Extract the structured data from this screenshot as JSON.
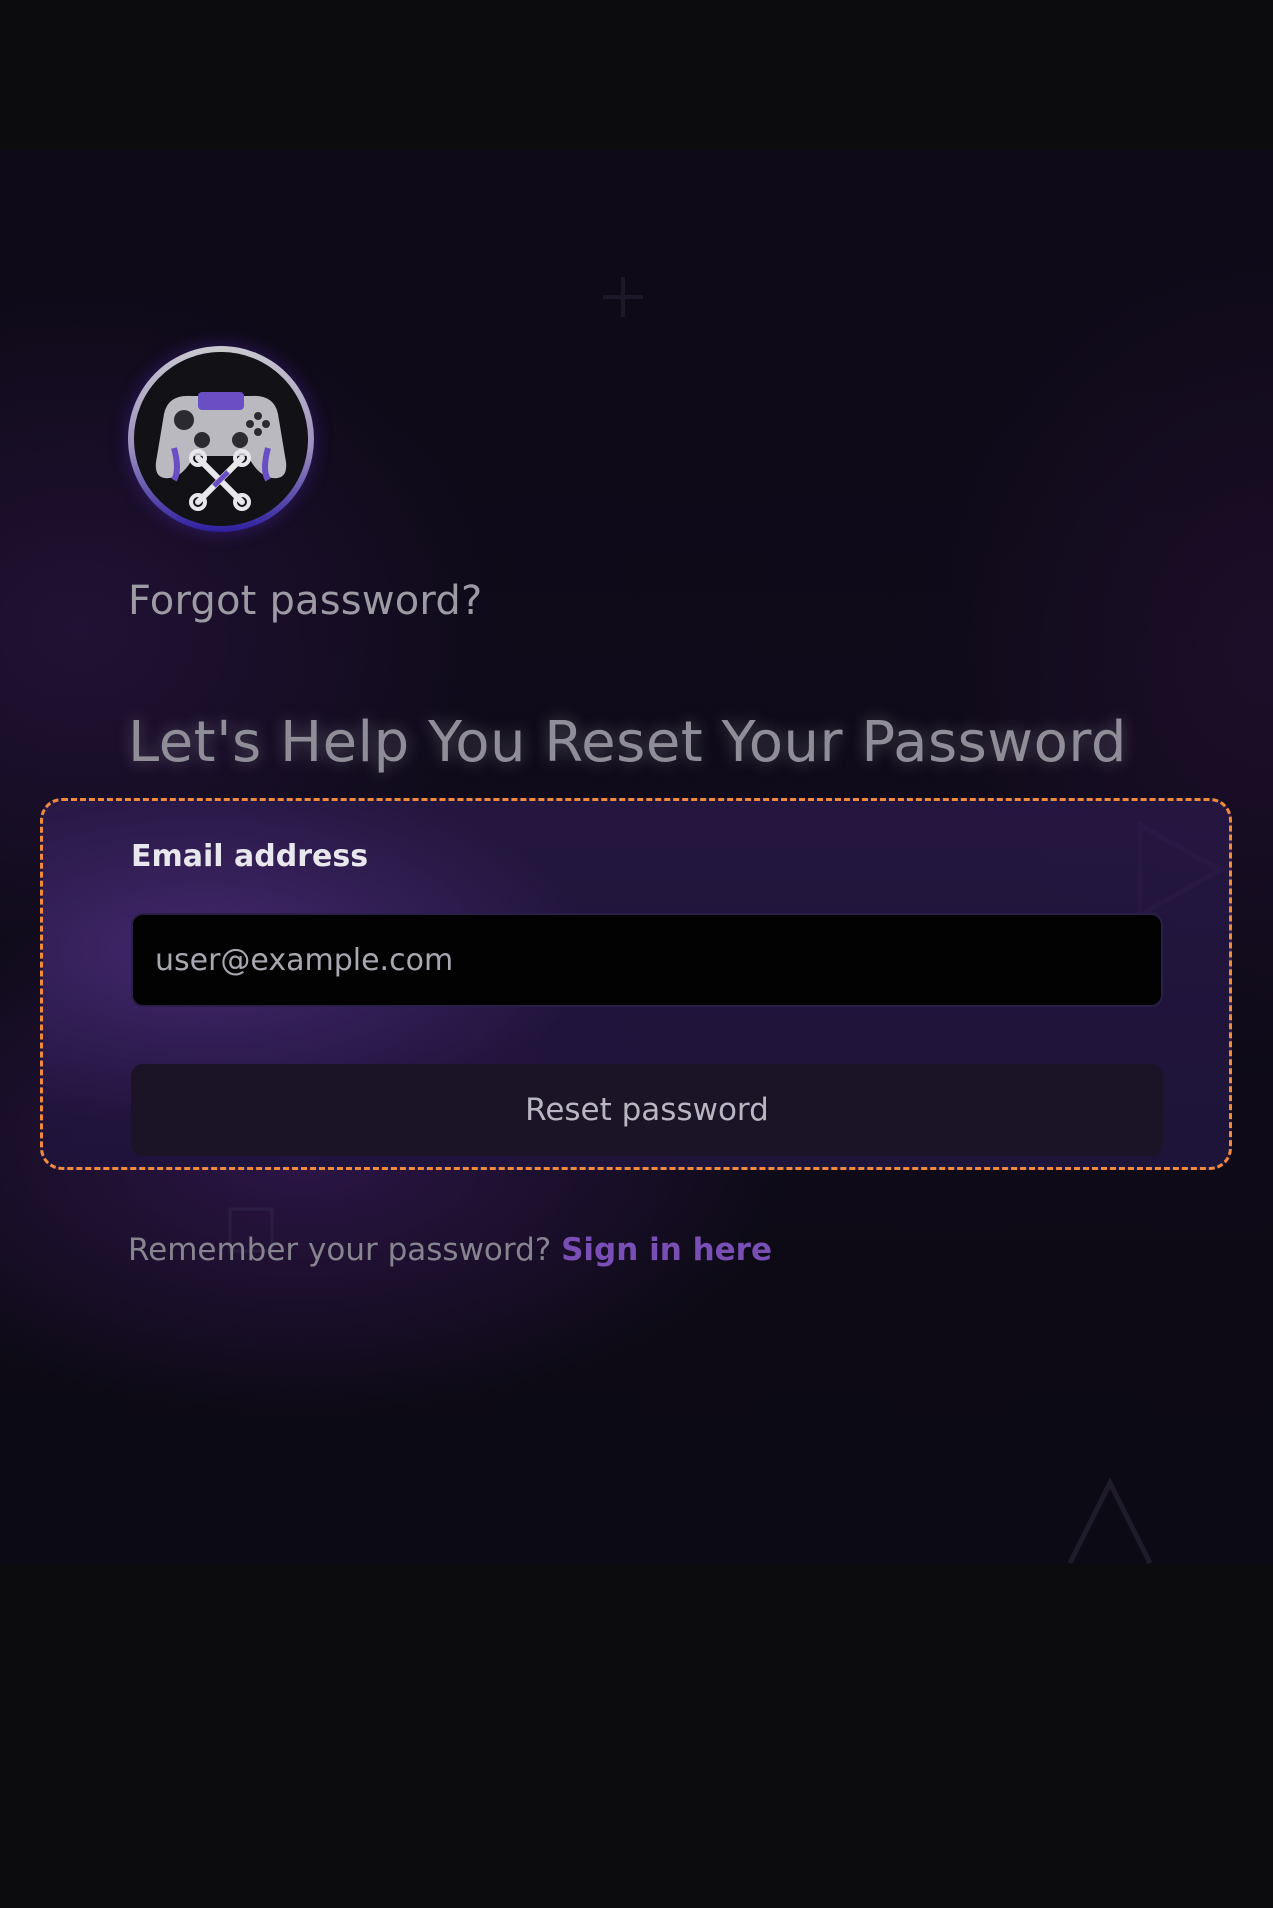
{
  "brand": {
    "logo_icon": "gamepad-wrench-logo-icon"
  },
  "header": {
    "subtitle": "Forgot password?",
    "title": "Let's Help You Reset Your Password"
  },
  "form": {
    "email_label": "Email address",
    "email_placeholder": "user@example.com",
    "email_value": "",
    "submit_label": "Reset password"
  },
  "footer": {
    "remember_text": "Remember your password?",
    "signin_link": "Sign in here"
  },
  "colors": {
    "accent": "#7a4fb5",
    "highlight_outline": "#f08a3c",
    "background": "#0c0c0e"
  }
}
